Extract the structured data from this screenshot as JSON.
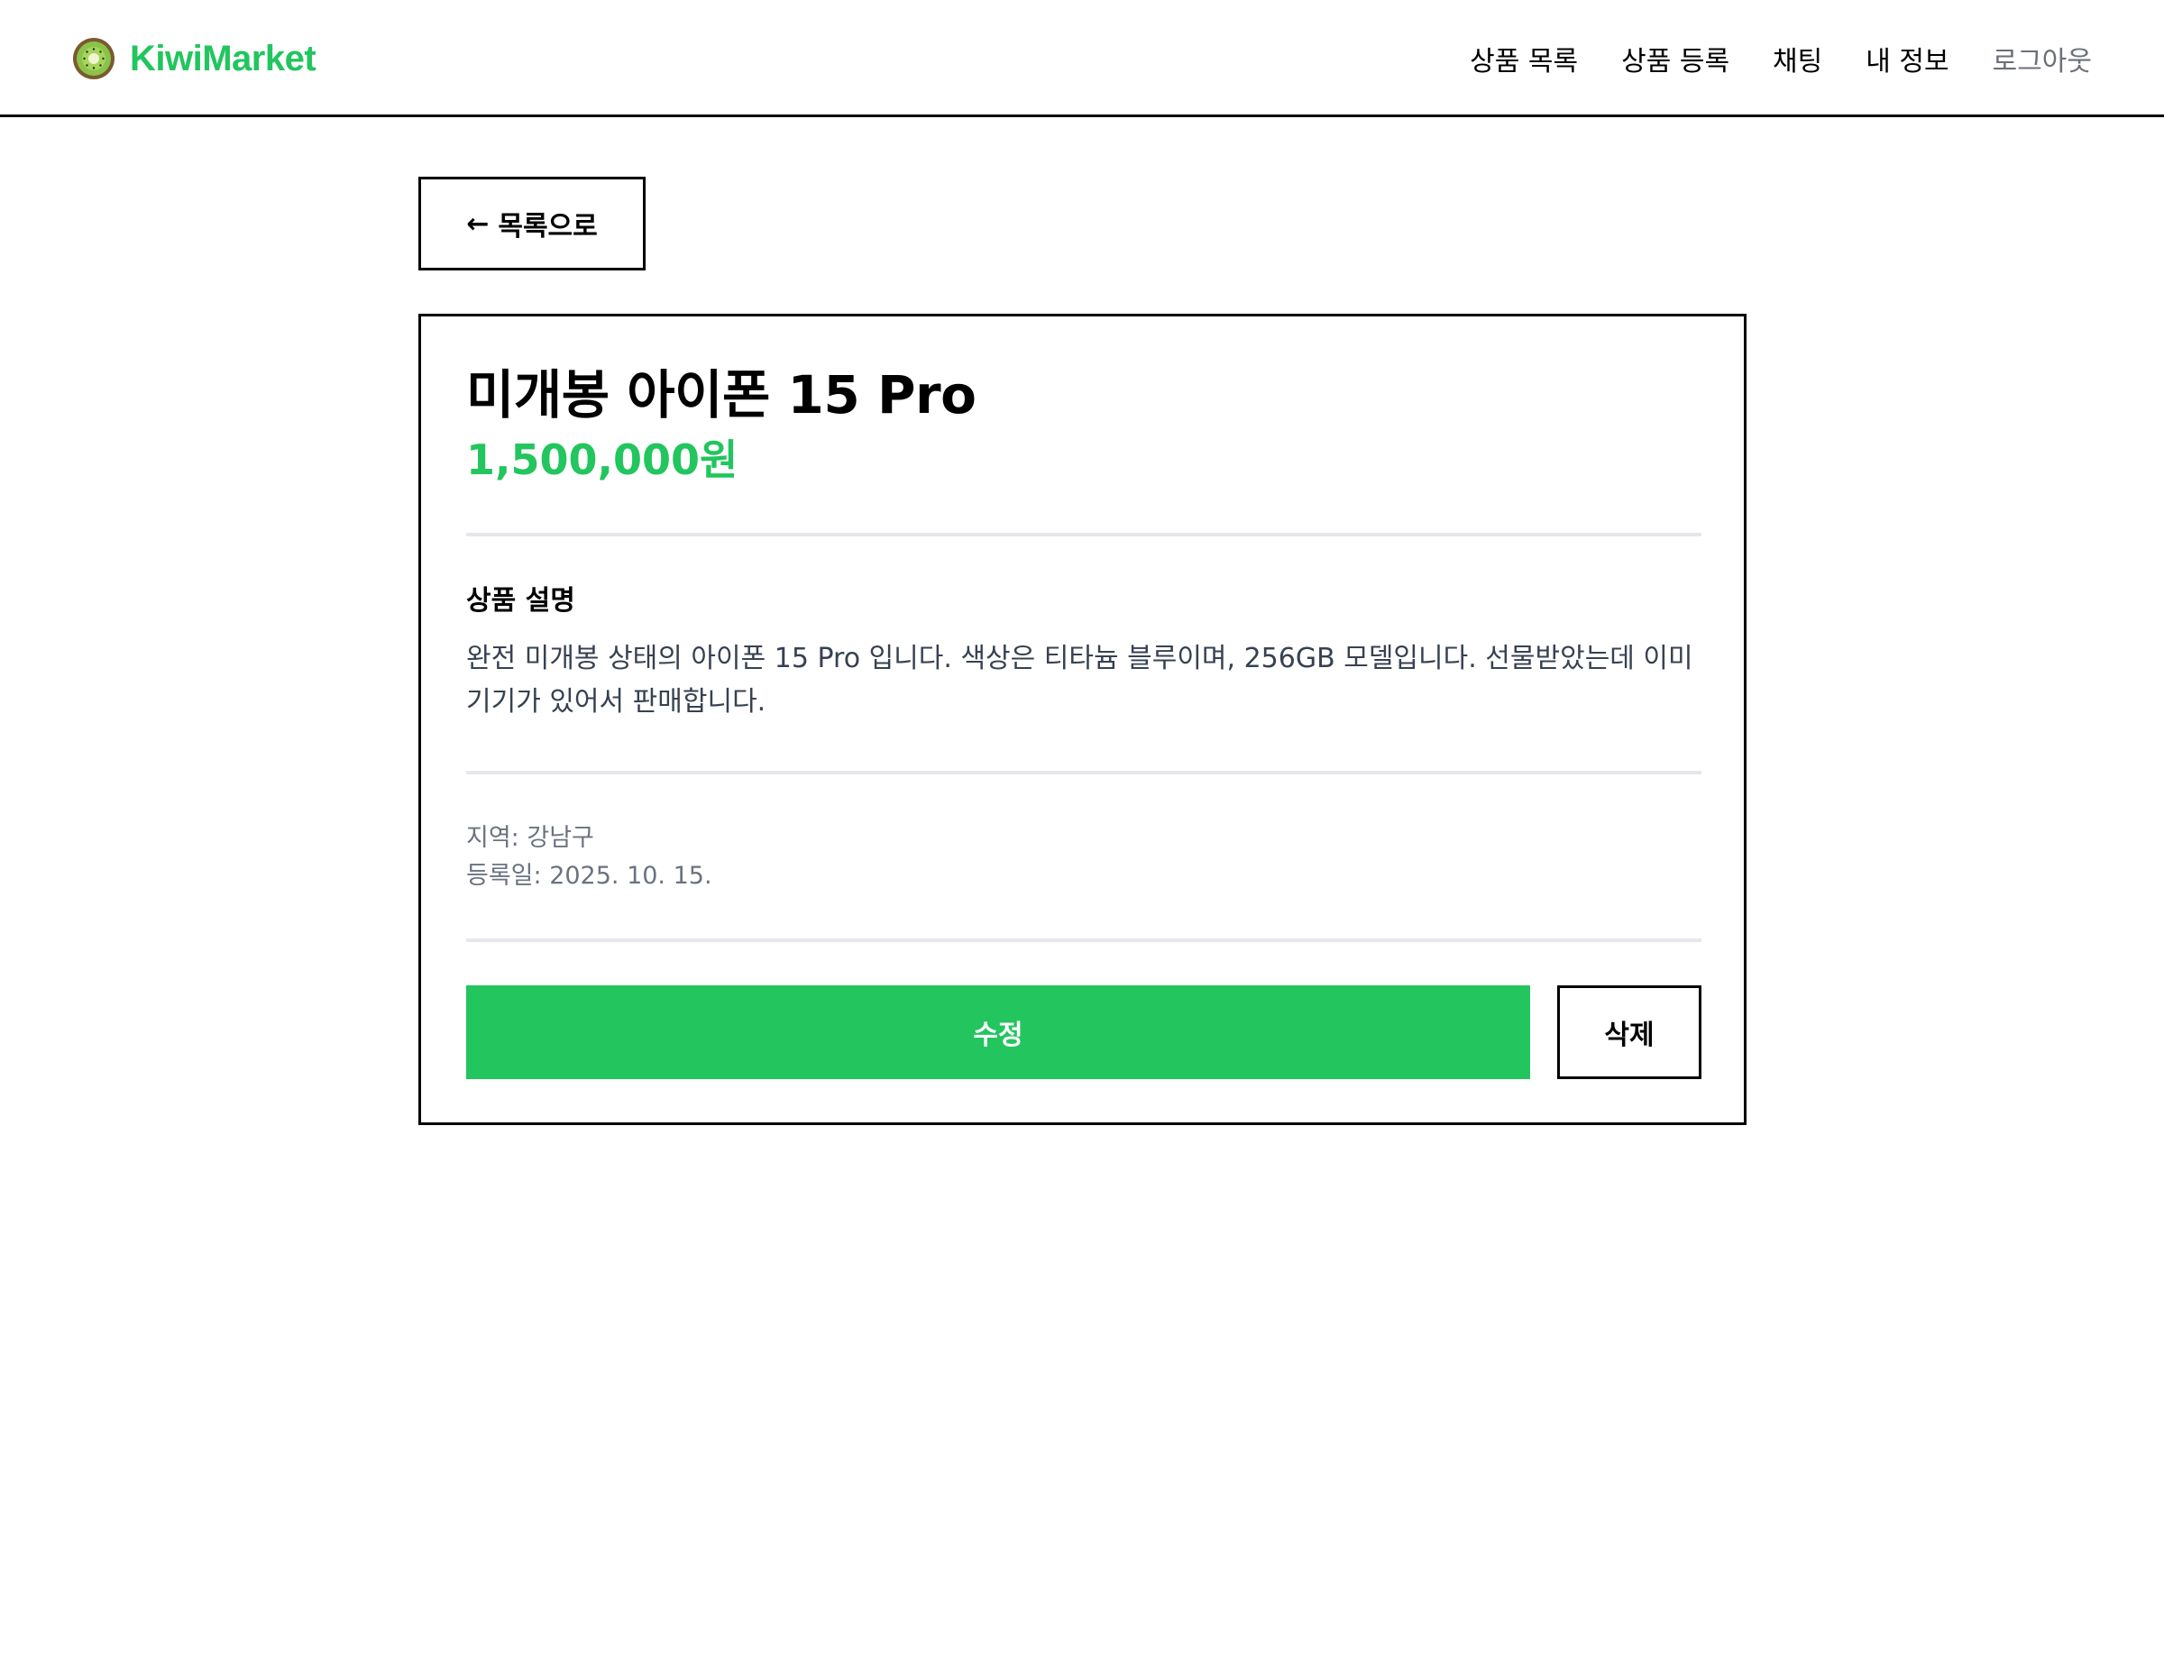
{
  "header": {
    "logo_text": "KiwiMarket",
    "logo_icon": "kiwi-icon",
    "brand_color": "#22c55e",
    "nav": {
      "product_list": "상품 목록",
      "product_register": "상품 등록",
      "chat": "채팅",
      "my_info": "내 정보",
      "logout": "로그아웃"
    }
  },
  "back_button": {
    "icon": "arrow-left-icon",
    "arrow": "←",
    "label": "목록으로"
  },
  "product": {
    "title": "미개봉 아이폰 15 Pro",
    "price": "1,500,000원",
    "description_heading": "상품 설명",
    "description": "완전 미개봉 상태의 아이폰 15 Pro 입니다. 색상은 티타늄 블루이며, 256GB 모델입니다. 선물받았는데 이미 기기가 있어서 판매합니다.",
    "location": "지역: 강남구",
    "registered": "등록일: 2025. 10. 15."
  },
  "actions": {
    "edit_label": "수정",
    "delete_label": "삭제",
    "edit_color": "#22c55e"
  }
}
